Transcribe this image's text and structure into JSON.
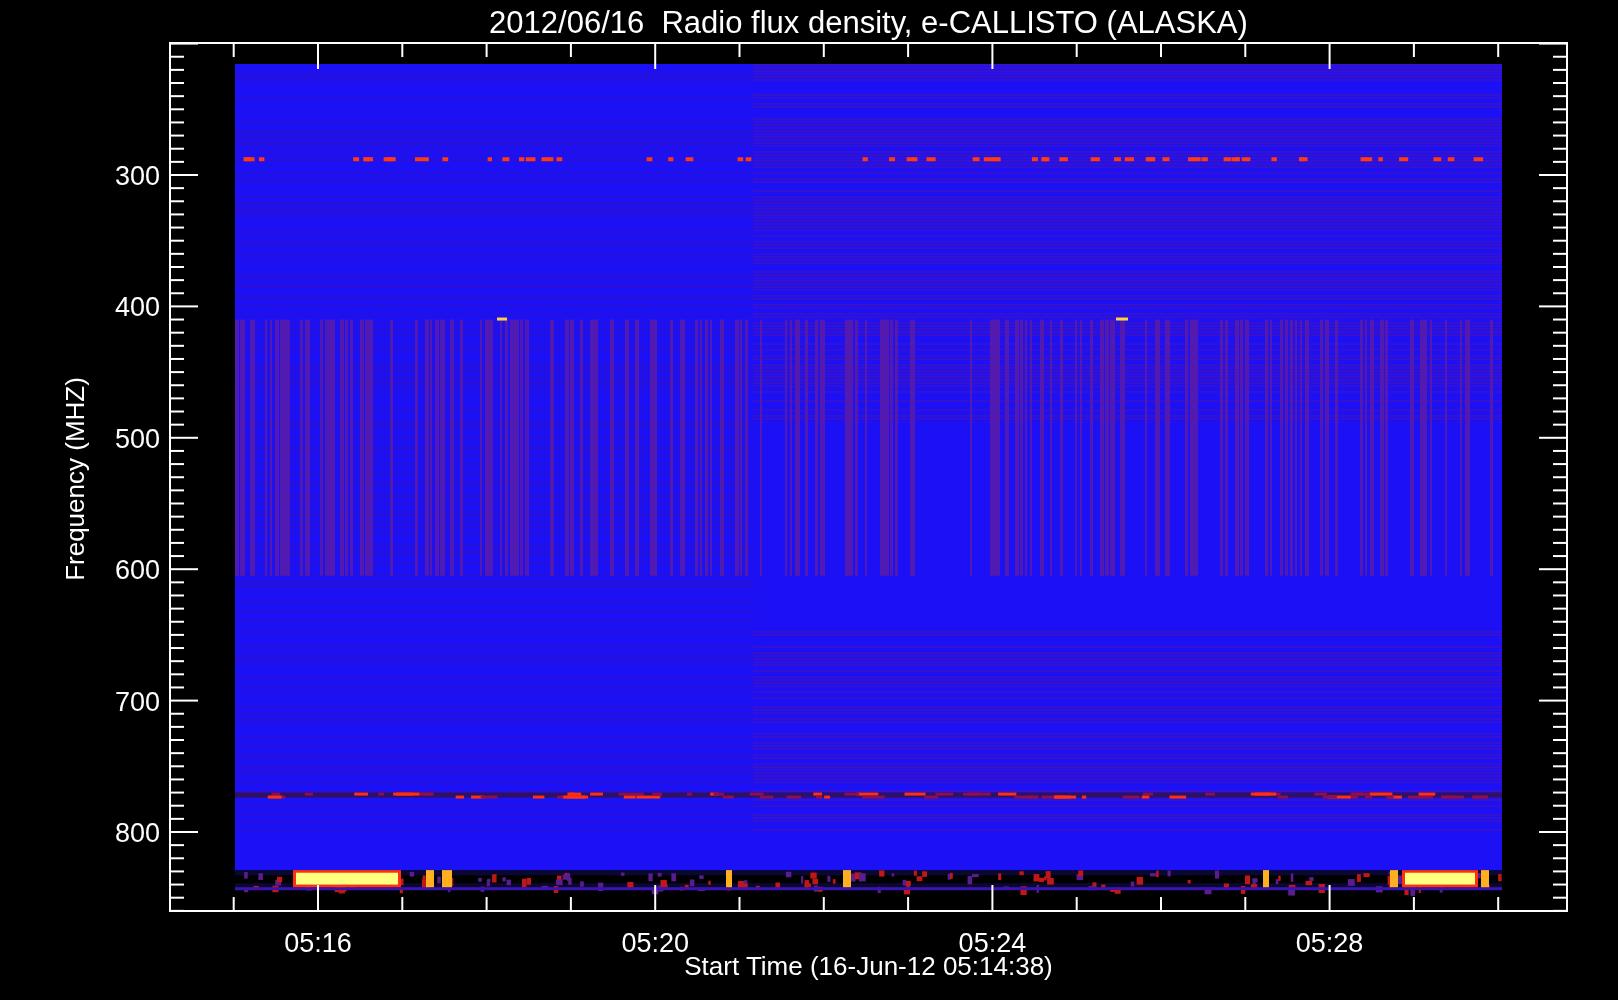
{
  "title": "2012/06/16  Radio flux density, e-CALLISTO (ALASKA)",
  "y_axis": {
    "label": "Frequency (MHZ)",
    "ticks": [
      "300",
      "400",
      "500",
      "600",
      "700",
      "800"
    ]
  },
  "x_axis": {
    "label": "Start Time (16-Jun-12 05:14:38)",
    "ticks": [
      "05:16",
      "05:20",
      "05:24",
      "05:28"
    ]
  }
}
